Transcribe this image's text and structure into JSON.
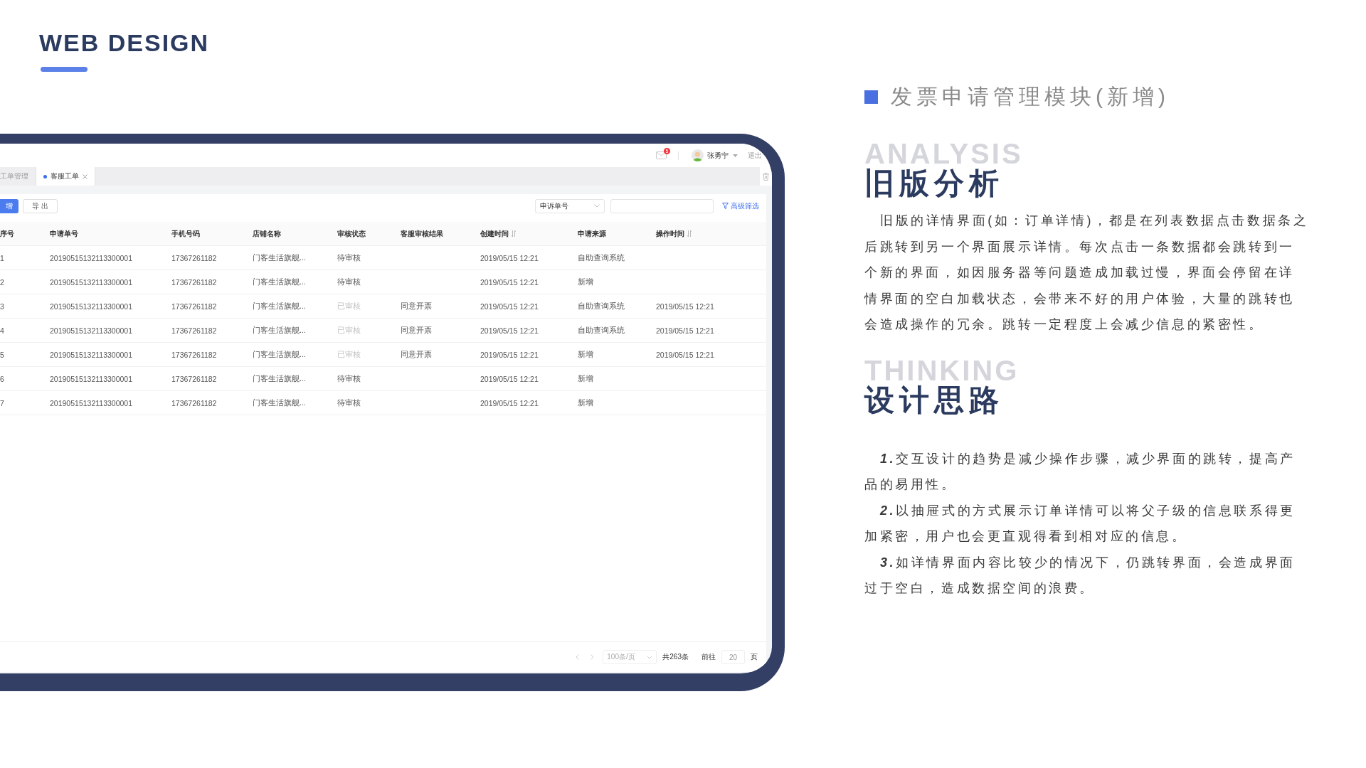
{
  "header": {
    "title": "WEB DESIGN"
  },
  "app": {
    "topbar": {
      "mail_badge": "5",
      "user": "张勇宁",
      "logout": "退出"
    },
    "tabs": [
      {
        "label": "工单管理",
        "selected": false,
        "closable": false
      },
      {
        "label": "客服工单",
        "selected": true,
        "closable": true
      }
    ],
    "toolbar": {
      "buttons": [
        {
          "label": "增",
          "kind": "primary"
        },
        {
          "label": "导 出",
          "kind": "default"
        }
      ],
      "select": {
        "value": "申诉单号"
      },
      "filter_link": "高级筛选"
    },
    "table": {
      "columns": [
        {
          "label": "序号",
          "sortable": false
        },
        {
          "label": "申请单号",
          "sortable": false
        },
        {
          "label": "手机号码",
          "sortable": false
        },
        {
          "label": "店铺名称",
          "sortable": false
        },
        {
          "label": "审核状态",
          "sortable": false
        },
        {
          "label": "客服审核结果",
          "sortable": false
        },
        {
          "label": "创建时间",
          "sortable": true
        },
        {
          "label": "申请来源",
          "sortable": false
        },
        {
          "label": "操作时间",
          "sortable": true
        }
      ],
      "rows": [
        {
          "index": "1",
          "order_no": "20190515132113300001",
          "phone": "17367261182",
          "store": "门客生活旗舰...",
          "status": {
            "text": "待审核",
            "done": false
          },
          "created": "2019/05/15   12:21",
          "source": "自助查询系统"
        },
        {
          "index": "2",
          "order_no": "20190515132113300001",
          "phone": "17367261182",
          "store": "门客生活旗舰...",
          "status": {
            "text": "待审核",
            "done": false
          },
          "created": "2019/05/15   12:21",
          "source": "新增"
        },
        {
          "index": "3",
          "order_no": "20190515132113300001",
          "phone": "17367261182",
          "store": "门客生活旗舰...",
          "status": {
            "text": "已审核",
            "done": true
          },
          "result": "同意开票",
          "created": "2019/05/15   12:21",
          "source": "自助查询系统",
          "operated": "2019/05/15   12:21"
        },
        {
          "index": "4",
          "order_no": "20190515132113300001",
          "phone": "17367261182",
          "store": "门客生活旗舰...",
          "status": {
            "text": "已审核",
            "done": true
          },
          "result": "同意开票",
          "created": "2019/05/15   12:21",
          "source": "自助查询系统",
          "operated": "2019/05/15   12:21"
        },
        {
          "index": "5",
          "order_no": "20190515132113300001",
          "phone": "17367261182",
          "store": "门客生活旗舰...",
          "status": {
            "text": "已审核",
            "done": true
          },
          "result": "同意开票",
          "created": "2019/05/15   12:21",
          "source": "新增",
          "operated": "2019/05/15   12:21"
        },
        {
          "index": "6",
          "order_no": "20190515132113300001",
          "phone": "17367261182",
          "store": "门客生活旗舰...",
          "status": {
            "text": "待审核",
            "done": false
          },
          "created": "2019/05/15   12:21",
          "source": "新增"
        },
        {
          "index": "7",
          "order_no": "20190515132113300001",
          "phone": "17367261182",
          "store": "门客生活旗舰...",
          "status": {
            "text": "待审核",
            "done": false
          },
          "created": "2019/05/15   12:21",
          "source": "新增"
        }
      ]
    },
    "pagination": {
      "page_size": "100条/页",
      "total": "共263条",
      "goto_label": "前往",
      "page": "20",
      "page_unit": "页"
    }
  },
  "side": {
    "module_title": "发票申请管理模块(新增)",
    "sections": [
      {
        "kind": "paragraphs",
        "ghost": "ANALYSIS",
        "heading": "旧版分析",
        "paragraphs": [
          "旧版的详情界面(如：订单详情)，都是在列表数据点击数据条之后跳转到另一个界面展示详情。每次点击一条数据都会跳转到一个新的界面，如因服务器等问题造成加载过慢，界面会停留在详情界面的空白加载状态，会带来不好的用户体验，大量的跳转也会造成操作的冗余。跳转一定程度上会减少信息的紧密性。"
        ]
      },
      {
        "kind": "list",
        "ghost": "THINKING",
        "heading": "设计思路",
        "paragraphs": [
          "**1.**交互设计的趋势是减少操作步骤，减少界面的跳转，提高产品的易用性。",
          "**2.**以抽屉式的方式展示订单详情可以将父子级的信息联系得更加紧密，用户也会更直观得看到相对应的信息。",
          "**3.**如详情界面内容比较少的情况下，仍跳转界面，会造成界面过于空白，造成数据空间的浪费。"
        ]
      }
    ]
  }
}
